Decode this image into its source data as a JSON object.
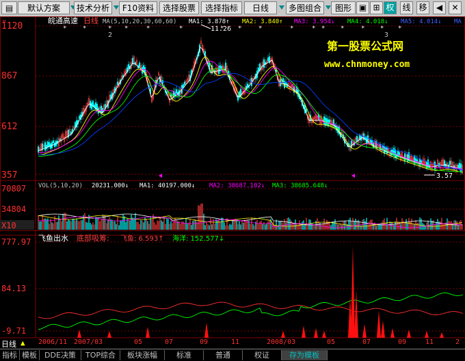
{
  "toolbar": {
    "buttons": [
      "默认方案",
      "技术分析",
      "F10资料",
      "选择股票",
      "选择指标",
      "日线",
      "多图组合",
      "图形叠"
    ],
    "icon_labels": [
      "权",
      "线",
      "移"
    ]
  },
  "stock": {
    "name": "皖通高速",
    "period": "日线",
    "ma_label": "MA(5,10,20,30,60,60)",
    "ma1": "MA1: 3.878↑",
    "ma2": "MA2: 3.840↑",
    "ma3": "MA3: 3.954↓",
    "ma4": "MA4: 4.018↓",
    "ma5": "MA5: 4.014↓",
    "ma6": "MA"
  },
  "price_axis": {
    "labels": [
      "1120",
      "867",
      "612",
      "357"
    ]
  },
  "annotations": {
    "high": "11.26",
    "low": "3.57",
    "mark2": "2",
    "mark3": "3"
  },
  "watermark": {
    "line1": "第一股票公式网",
    "line2": "www.chnmoney.com"
  },
  "volume": {
    "label": "VOL(5,10,20)",
    "value": "20231.000↓",
    "ma1": "MA1: 40197.000↓",
    "ma2": "MA2: 38687.102↓",
    "ma3": "MA3: 38685.648↓",
    "axis": [
      "70807",
      "34804",
      "X10"
    ]
  },
  "indicator": {
    "name": "飞鱼出水",
    "l1": "底部吸筹:",
    "l2": "飞鱼: 6.593↑",
    "l3": "海洋: 152.577↓",
    "axis": [
      "777.97",
      "84.13",
      "-9.71"
    ]
  },
  "date_axis": {
    "prefix": "日线",
    "labels": [
      "2006/11",
      "2007/03",
      "05",
      "07",
      "09",
      "11",
      "2008/03",
      "05",
      "07",
      "09",
      "11",
      "2"
    ]
  },
  "status_tabs": [
    "指标",
    "模板",
    "DDE决策",
    "TOP综合",
    "板块涨幅",
    "标准",
    "普通",
    "权证",
    "存为模板"
  ],
  "colors": {
    "up": "#ff4040",
    "down": "#00ffff",
    "ma1": "#ffffff",
    "ma2": "#ffff00",
    "ma3": "#ff00ff",
    "ma4": "#00ff00",
    "ma5": "#0040ff",
    "axis_text": "#ff3030",
    "watermark": "#ffff00",
    "grid": "#800000"
  }
}
